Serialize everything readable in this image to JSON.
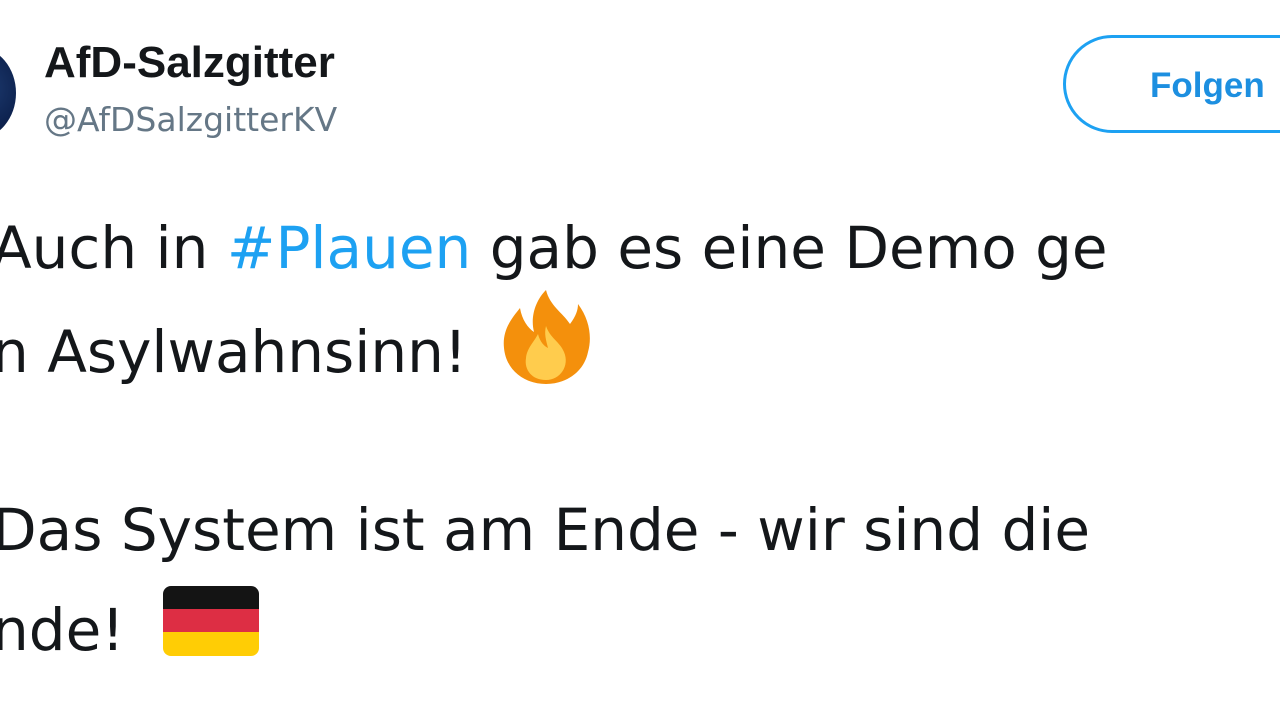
{
  "profile": {
    "display_name": "AfD-Salzgitter",
    "handle": "@AfDSalzgitterKV"
  },
  "follow_button": {
    "label": "Folgen"
  },
  "tweet": {
    "line1_before": "Auch in ",
    "hashtag": "#Plauen",
    "line1_after": " gab es eine Demo ge",
    "line2": "n Asylwahnsinn! ",
    "line3": " Das System ist am Ende - wir sind die",
    "line4": "nde!"
  },
  "icons": {
    "fire": "fire-emoji-icon",
    "flag": "germany-flag-emoji-icon"
  },
  "colors": {
    "accent": "#1da1f2",
    "text": "#14171a",
    "secondary_text": "#657786"
  }
}
